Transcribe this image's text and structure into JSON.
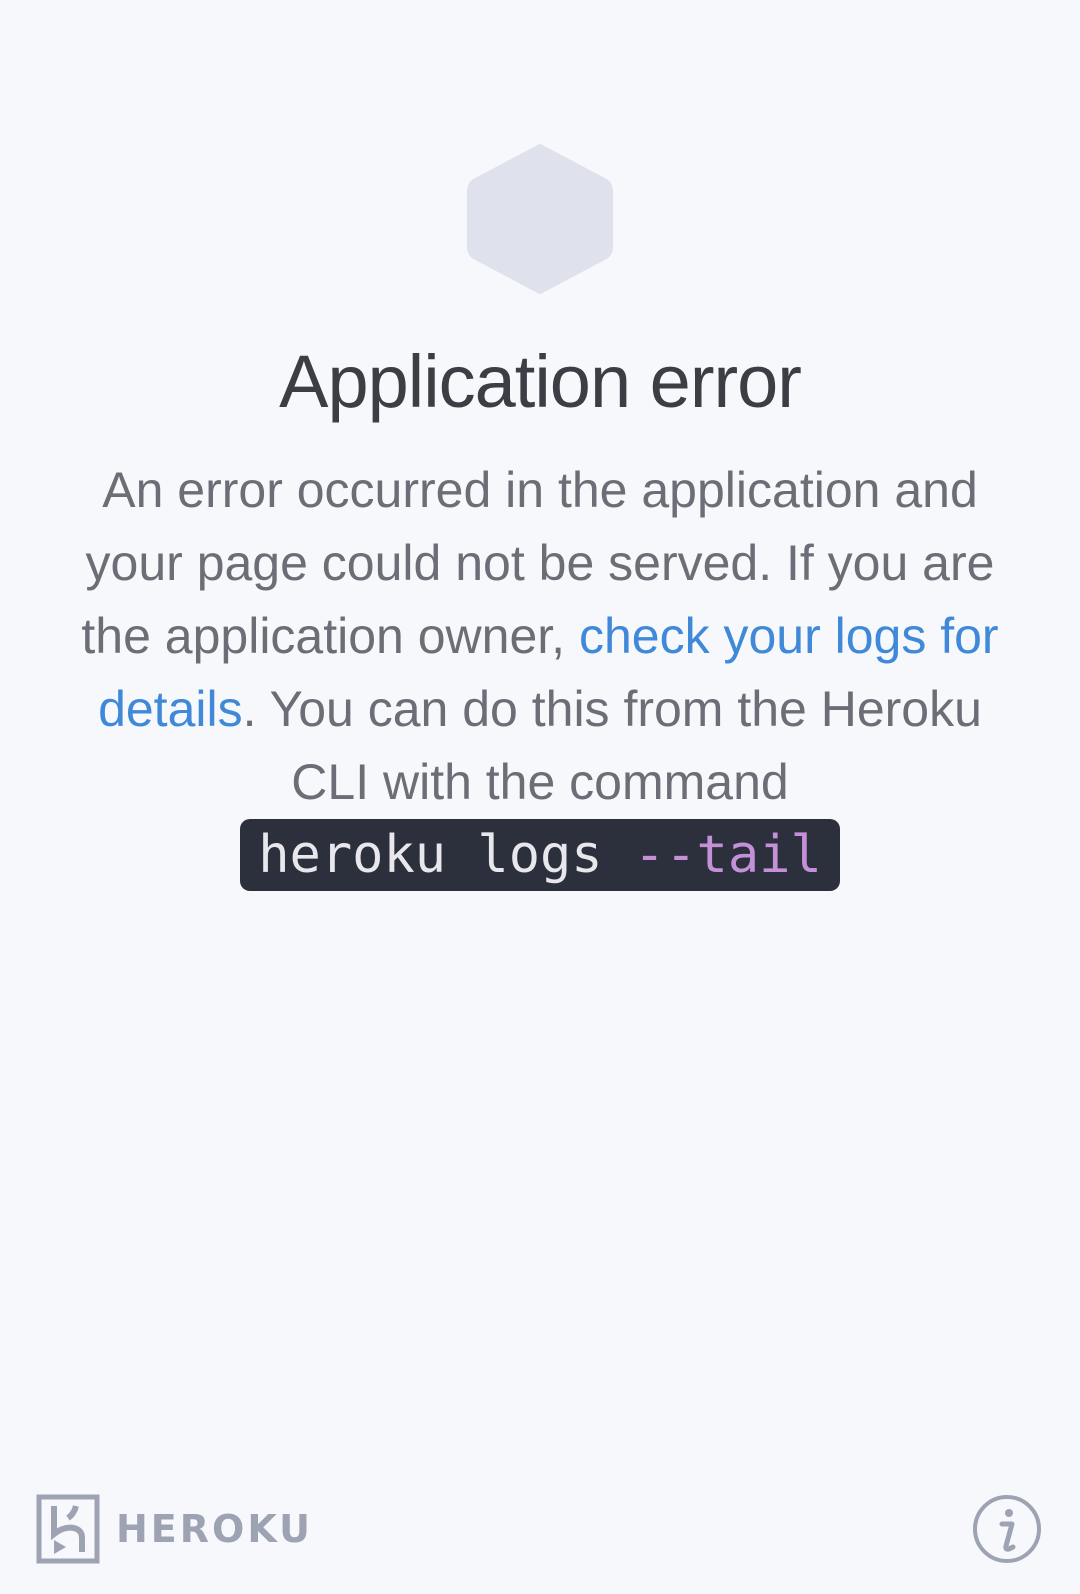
{
  "error": {
    "title": "Application error",
    "message_part1": "An error occurred in the application and your page could not be served. If you are the application owner, ",
    "link_text": "check your logs for details",
    "message_part2": ". You can do this from the Heroku CLI with the command",
    "command": "heroku logs",
    "command_flag": "--tail"
  },
  "footer": {
    "brand": "HEROKU",
    "info_icon": "info-icon"
  },
  "colors": {
    "background": "#f7f8fb",
    "link": "#3f89d8",
    "command_bg": "#2c2f3c",
    "command_flag": "#c490d8",
    "hexagon": "#dfe2ec"
  }
}
